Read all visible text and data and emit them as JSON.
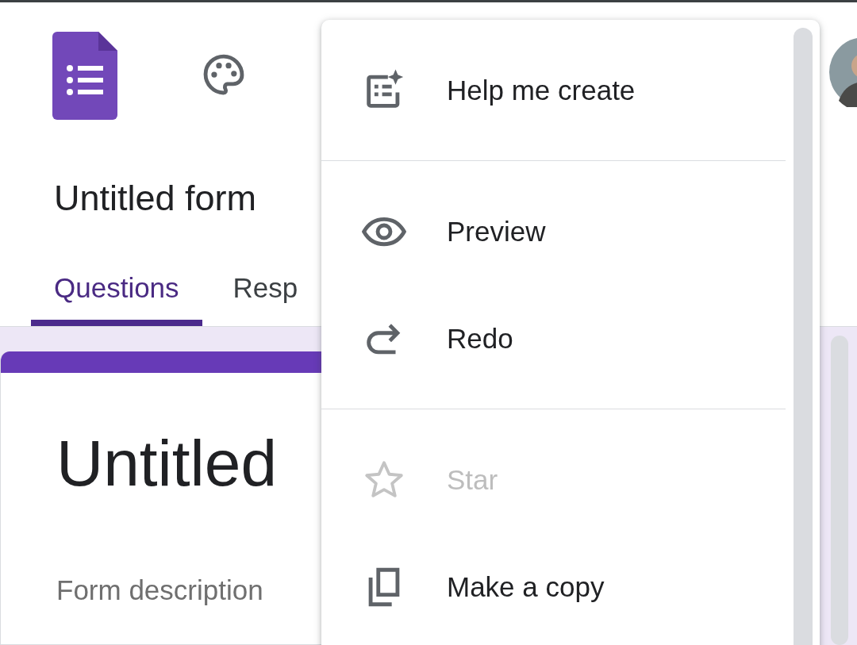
{
  "header": {
    "title": "Untitled form",
    "tabs": [
      {
        "label": "Questions",
        "selected": true
      },
      {
        "label": "Resp",
        "selected": false
      }
    ]
  },
  "form": {
    "title": "Untitled",
    "description": "Form description"
  },
  "menu": {
    "sections": [
      {
        "items": [
          {
            "label": "Help me create",
            "disabled": false
          }
        ]
      },
      {
        "items": [
          {
            "label": "Preview",
            "disabled": false
          },
          {
            "label": "Redo",
            "disabled": false
          }
        ]
      },
      {
        "items": [
          {
            "label": "Star",
            "disabled": true
          },
          {
            "label": "Make a copy",
            "disabled": false
          }
        ]
      }
    ]
  }
}
